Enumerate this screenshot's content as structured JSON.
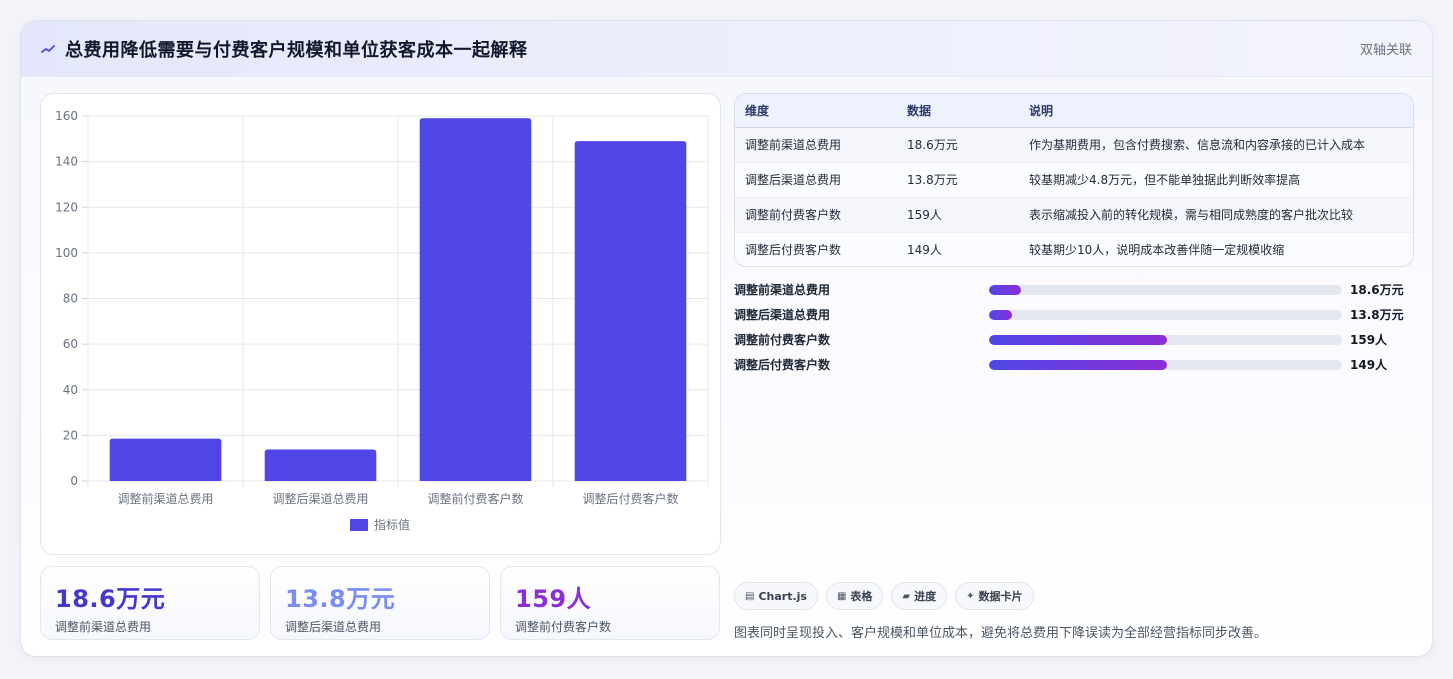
{
  "header": {
    "icon": "trend-icon",
    "title": "总费用降低需要与付费客户规模和单位获客成本一起解释",
    "tag": "双轴关联"
  },
  "chart_data": {
    "type": "bar",
    "categories": [
      "调整前渠道总费用",
      "调整后渠道总费用",
      "调整前付费客户数",
      "调整后付费客户数"
    ],
    "series": [
      {
        "name": "指标值",
        "values": [
          18.6,
          13.8,
          159,
          149
        ]
      }
    ],
    "ylim": [
      0,
      160
    ],
    "yticks": [
      0,
      20,
      40,
      60,
      80,
      100,
      120,
      140,
      160
    ],
    "grid": true,
    "legend": "bottom",
    "color": "#4f46e5"
  },
  "stats": [
    {
      "value": "18.6万元",
      "label": "调整前渠道总费用",
      "color": "#4338ca"
    },
    {
      "value": "13.8万元",
      "label": "调整后渠道总费用",
      "color": "#7c8cf0"
    },
    {
      "value": "159人",
      "label": "调整前付费客户数",
      "color": "#8b2fd6"
    }
  ],
  "table": {
    "headers": [
      "维度",
      "数据",
      "说明"
    ],
    "rows": [
      [
        "调整前渠道总费用",
        "18.6万元",
        "作为基期费用，包含付费搜索、信息流和内容承接的已计入成本"
      ],
      [
        "调整后渠道总费用",
        "13.8万元",
        "较基期减少4.8万元，但不能单独据此判断效率提高"
      ],
      [
        "调整前付费客户数",
        "159人",
        "表示缩减投入前的转化规模，需与相同成熟度的客户批次比较"
      ],
      [
        "调整后付费客户数",
        "149人",
        "较基期少10人，说明成本改善伴随一定规模收缩"
      ]
    ]
  },
  "progress": [
    {
      "label": "调整前渠道总费用",
      "value": "18.6万元",
      "fraction": 0.09
    },
    {
      "label": "调整后渠道总费用",
      "value": "13.8万元",
      "fraction": 0.065
    },
    {
      "label": "调整前付费客户数",
      "value": "159人",
      "fraction": 0.505
    },
    {
      "label": "调整后付费客户数",
      "value": "149人",
      "fraction": 0.505
    }
  ],
  "chips": [
    {
      "icon": "chart-icon",
      "glyph": "▤",
      "label": "Chart.js"
    },
    {
      "icon": "table-icon",
      "glyph": "▦",
      "label": "表格"
    },
    {
      "icon": "progress-icon",
      "glyph": "▰",
      "label": "进度"
    },
    {
      "icon": "sparkle-icon",
      "glyph": "✦",
      "label": "数据卡片"
    }
  ],
  "note": "图表同时呈现投入、客户规模和单位成本，避免将总费用下降误读为全部经营指标同步改善。"
}
